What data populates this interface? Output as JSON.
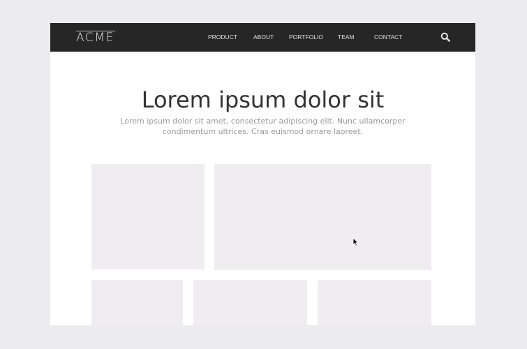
{
  "header": {
    "logo": "ACME",
    "nav": [
      {
        "label": "PRODUCT"
      },
      {
        "label": "ABOUT"
      },
      {
        "label": "PORTFOLIO"
      },
      {
        "label": "TEAM"
      },
      {
        "label": "CONTACT"
      }
    ],
    "search_icon": "search-icon"
  },
  "hero": {
    "title": "Lorem ipsum dolor sit",
    "subtitle": "Lorem ipsum dolor sit amet, consectetur adipiscing elit. Nunc ullamcorper condimentum ultrices. Cras euismod ornare laoreet."
  },
  "colors": {
    "page_background": "#ecebee",
    "navbar": "#262626",
    "placeholder_tile": "#efedf0",
    "title_text": "#333333",
    "subtitle_text": "#9a9a9a"
  }
}
